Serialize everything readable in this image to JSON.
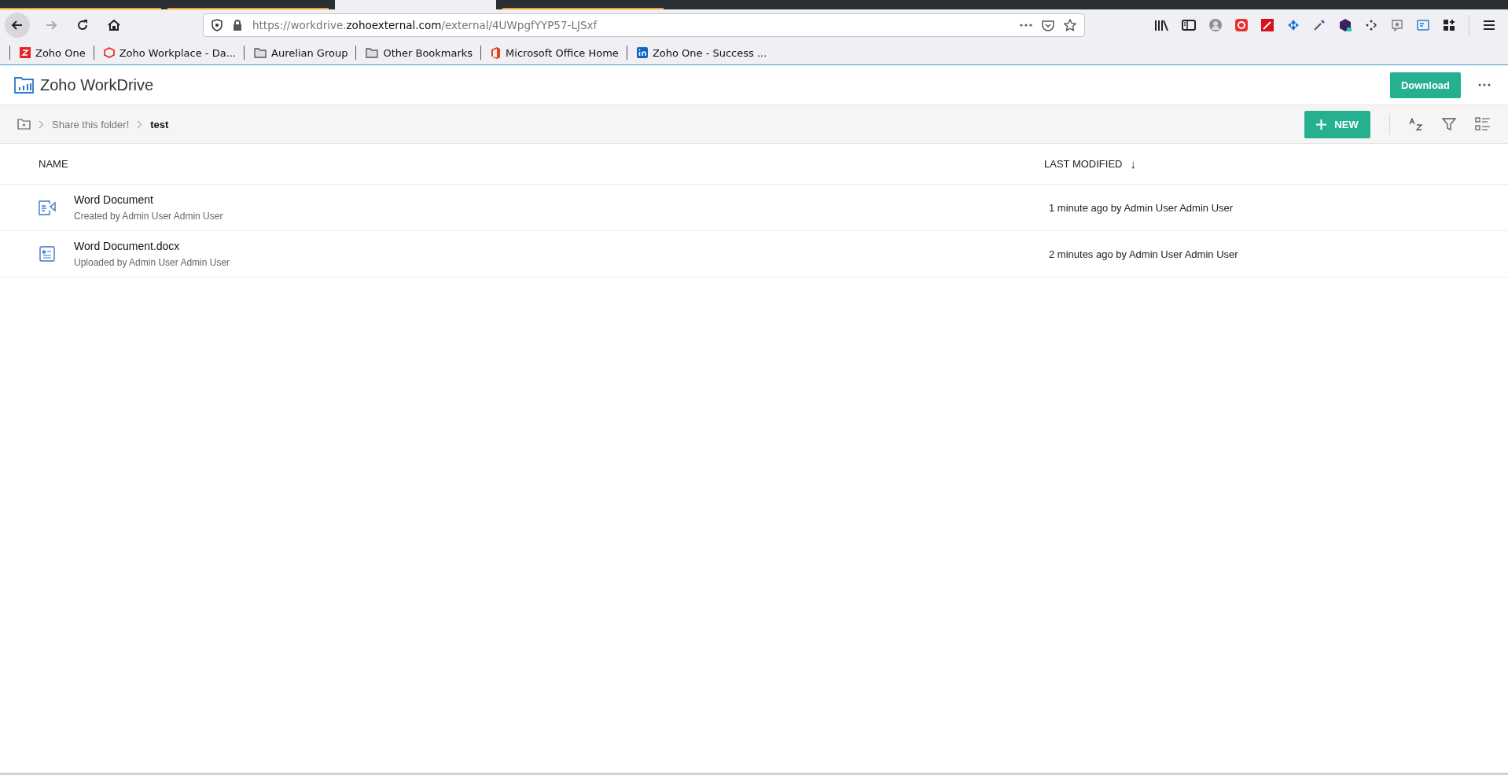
{
  "browser": {
    "tabs": [
      {
        "selected": false
      },
      {
        "selected": false
      },
      {
        "selected": true
      },
      {
        "selected": false
      }
    ],
    "url": {
      "prefix": "https://workdrive.",
      "domain": "zohoexternal.com",
      "path": "/external/4UWpgfYYP57-LJSxf"
    },
    "bookmarks": [
      {
        "label": "Zoho One",
        "kind": "zoho"
      },
      {
        "label": "Zoho Workplace - Da...",
        "kind": "workplace"
      },
      {
        "label": "Aurelian Group",
        "kind": "folder"
      },
      {
        "label": "Other Bookmarks",
        "kind": "folder"
      },
      {
        "label": "Microsoft Office Home",
        "kind": "office"
      },
      {
        "label": "Zoho One - Success ...",
        "kind": "linkedin"
      }
    ]
  },
  "app": {
    "title": "Zoho WorkDrive",
    "download": "Download"
  },
  "breadcrumbs": [
    {
      "label": "Share this folder!",
      "selected": false
    },
    {
      "label": "test",
      "selected": true
    }
  ],
  "new_button": "NEW",
  "columns": {
    "name": "NAME",
    "modified": "LAST MODIFIED",
    "sort_arrow": "↓"
  },
  "files": [
    {
      "kind": "writer",
      "name": "Word Document",
      "sub": "Created by Admin User Admin User",
      "modified": "1 minute ago by Admin User Admin User"
    },
    {
      "kind": "docx",
      "name": "Word Document.docx",
      "sub": "Uploaded by Admin User Admin User",
      "modified": "2 minutes ago by Admin User Admin User"
    }
  ]
}
